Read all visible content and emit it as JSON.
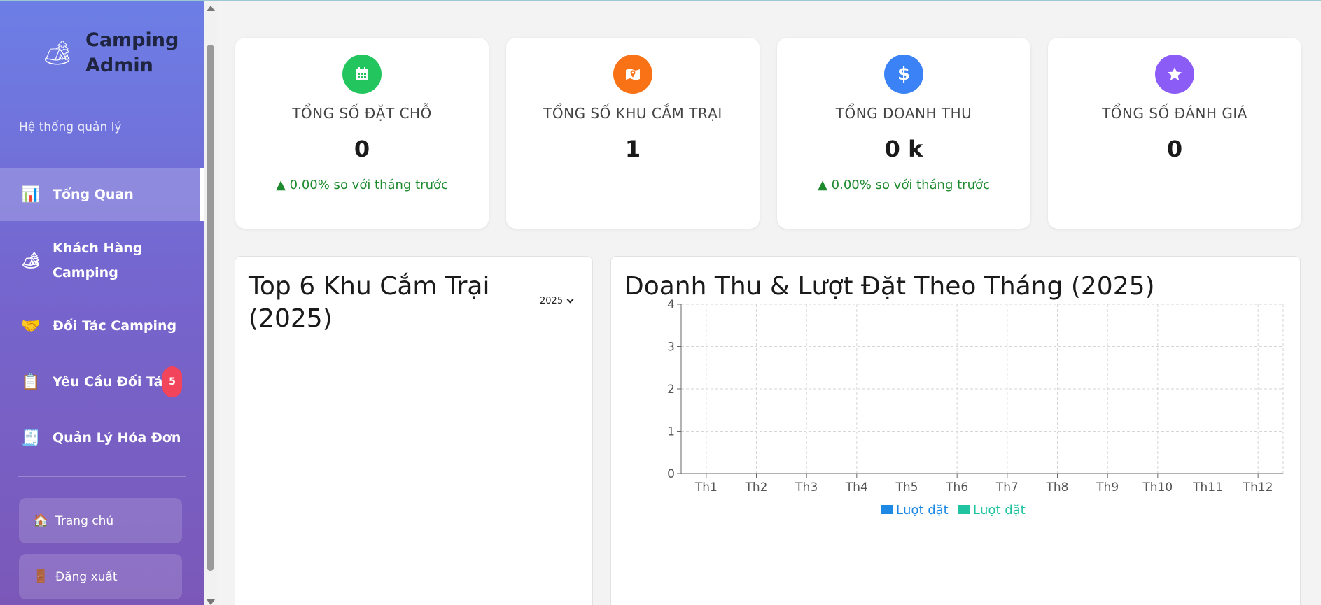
{
  "sidebar": {
    "brand_line1": "Camping",
    "brand_line2": "Admin",
    "subtitle": "Hệ thống quản lý",
    "items": [
      {
        "label": "Tổng Quan",
        "icon": "bar-chart-icon"
      },
      {
        "label": "Khách Hàng Camping",
        "icon": "camping-icon"
      },
      {
        "label": "Đối Tác Camping",
        "icon": "handshake-icon"
      },
      {
        "label": "Yêu Cầu Đối Tác",
        "icon": "clipboard-icon",
        "badge": "5"
      },
      {
        "label": "Quản Lý Hóa Đơn",
        "icon": "receipt-icon"
      }
    ],
    "home_label": "Trang chủ",
    "logout_label": "Đăng xuất"
  },
  "stats": [
    {
      "label": "TỔNG SỐ ĐẶT CHỖ",
      "value": "0",
      "change": "▲ 0.00% so với tháng trước",
      "icon": "calendar-icon",
      "color": "#22c55e"
    },
    {
      "label": "TỔNG SỐ KHU CẮM TRẠI",
      "value": "1",
      "change": "",
      "icon": "map-pin-icon",
      "color": "#f97316"
    },
    {
      "label": "TỔNG DOANH THU",
      "value": "0 k",
      "change": "▲ 0.00% so với tháng trước",
      "icon": "dollar-icon",
      "color": "#3b82f6"
    },
    {
      "label": "TỔNG SỐ ĐÁNH GIÁ",
      "value": "0",
      "change": "",
      "icon": "star-icon",
      "color": "#8b5cf6"
    }
  ],
  "top_panel": {
    "title": "Top 6 Khu Cắm Trại (2025)",
    "year": "2025"
  },
  "chart_panel": {
    "title": "Doanh Thu & Lượt Đặt Theo Tháng (2025)"
  },
  "chart_data": {
    "type": "bar",
    "categories": [
      "Th1",
      "Th2",
      "Th3",
      "Th4",
      "Th5",
      "Th6",
      "Th7",
      "Th8",
      "Th9",
      "Th10",
      "Th11",
      "Th12"
    ],
    "series": [
      {
        "name": "Lượt đặt",
        "color": "#1e88e5",
        "values": [
          0,
          0,
          0,
          0,
          0,
          0,
          0,
          0,
          0,
          0,
          0,
          0
        ]
      },
      {
        "name": "Lượt đặt",
        "color": "#20c4a0",
        "values": [
          0,
          0,
          0,
          0,
          0,
          0,
          0,
          0,
          0,
          0,
          0,
          0
        ]
      }
    ],
    "yticks": [
      "0",
      "1",
      "2",
      "3",
      "4"
    ],
    "ylim": [
      0,
      4
    ],
    "grid": true,
    "legend": "bottom"
  }
}
